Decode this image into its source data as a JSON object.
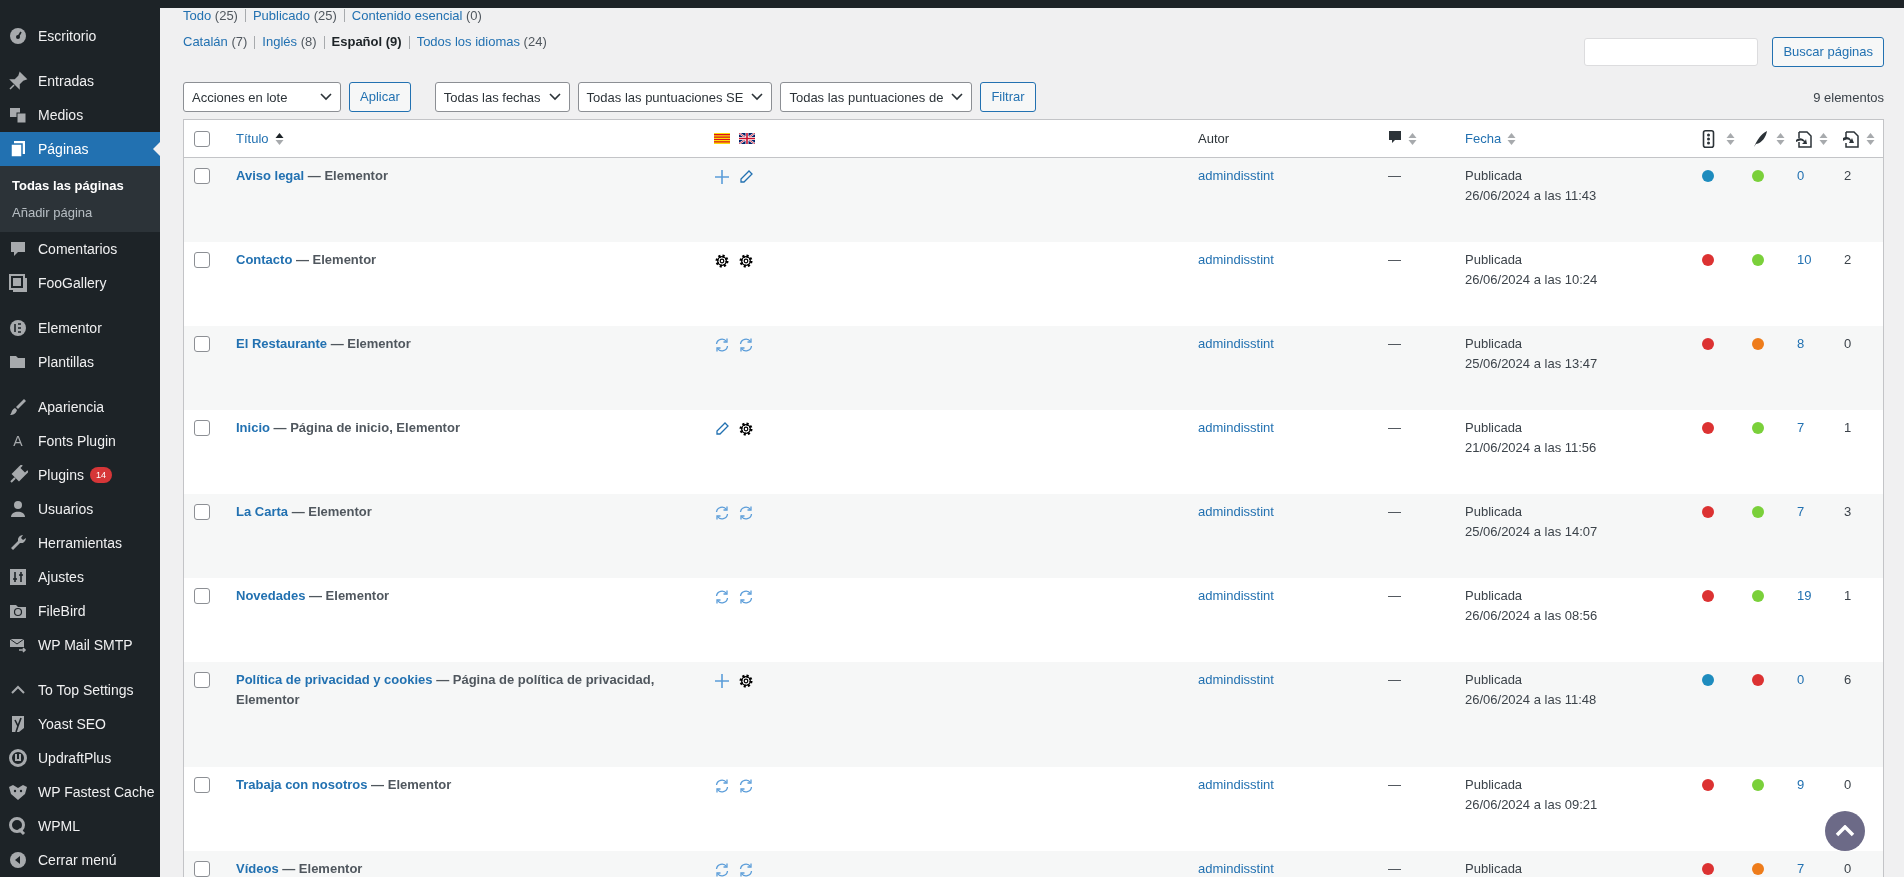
{
  "sidebar": {
    "groups": [
      {
        "items": [
          {
            "label": "Escritorio",
            "selected": false
          }
        ]
      },
      {
        "items": [
          {
            "label": "Entradas",
            "selected": false
          },
          {
            "label": "Medios",
            "selected": false
          },
          {
            "label": "Páginas",
            "selected": true,
            "children": [
              {
                "label": "Todas las páginas",
                "selected": true
              },
              {
                "label": "Añadir página",
                "selected": false
              }
            ]
          },
          {
            "label": "Comentarios",
            "selected": false
          },
          {
            "label": "FooGallery",
            "selected": false
          }
        ]
      },
      {
        "items": [
          {
            "label": "Elementor",
            "selected": false
          },
          {
            "label": "Plantillas",
            "selected": false
          }
        ]
      },
      {
        "items": [
          {
            "label": "Apariencia",
            "selected": false
          },
          {
            "label": "Fonts Plugin",
            "selected": false,
            "glyph": "A"
          },
          {
            "label": "Plugins",
            "selected": false,
            "badge": "14"
          },
          {
            "label": "Usuarios",
            "selected": false
          },
          {
            "label": "Herramientas",
            "selected": false
          },
          {
            "label": "Ajustes",
            "selected": false
          },
          {
            "label": "FileBird",
            "selected": false
          },
          {
            "label": "WP Mail SMTP",
            "selected": false
          }
        ]
      },
      {
        "items": [
          {
            "label": "To Top Settings",
            "selected": false
          },
          {
            "label": "Yoast SEO",
            "selected": false
          },
          {
            "label": "UpdraftPlus",
            "selected": false
          },
          {
            "label": "WP Fastest Cache",
            "selected": false
          },
          {
            "label": "WPML",
            "selected": false
          },
          {
            "label": "Cerrar menú",
            "selected": false
          }
        ]
      }
    ]
  },
  "status_filters": [
    {
      "label": "Todo",
      "count": "(25)"
    },
    {
      "label": "Publicado",
      "count": "(25)"
    },
    {
      "label": "Contenido esencial",
      "count": "(0)"
    }
  ],
  "language_filters": [
    {
      "label": "Catalán",
      "count": "(7)",
      "selected": false
    },
    {
      "label": "Inglés",
      "count": "(8)",
      "selected": false
    },
    {
      "label": "Español",
      "count": "(9)",
      "selected": true
    },
    {
      "label": "Todos los idiomas",
      "count": "(24)",
      "selected": false
    }
  ],
  "search": {
    "button": "Buscar páginas"
  },
  "tablenav": {
    "bulk_actions": "Acciones en lote",
    "apply": "Aplicar",
    "dropdowns": [
      "Todas las fechas",
      "Todas las puntuaciones SE",
      "Todas las puntuaciones de"
    ],
    "filter": "Filtrar",
    "count": "9 elementos"
  },
  "table": {
    "select_all_checked": false,
    "columns": [
      {
        "kind": "title",
        "label": "Título",
        "sorted": true
      },
      {
        "kind": "flags"
      },
      {
        "kind": "author",
        "label": "Autor"
      },
      {
        "kind": "comments",
        "sorted": false
      },
      {
        "kind": "date",
        "label": "Fecha",
        "sorted": false
      },
      {
        "kind": "seo",
        "sorted": false
      },
      {
        "kind": "readability",
        "sorted": false
      },
      {
        "kind": "links",
        "sorted": false
      },
      {
        "kind": "linked",
        "sorted": false
      }
    ],
    "rows": [
      {
        "checked": false,
        "title": "Aviso legal",
        "suffix": "— Elementor",
        "translations": [
          {
            "kind": "add"
          },
          {
            "kind": "edit"
          }
        ],
        "author": "admindisstint",
        "comments": "—",
        "status": "Publicada",
        "date": "26/06/2024 a las 11:43",
        "seo": {
          "color": "#1e8cbe"
        },
        "readability": {
          "color": "#7ad03a"
        },
        "links": "0",
        "linked": "2"
      },
      {
        "checked": false,
        "title": "Contacto",
        "suffix": "— Elementor",
        "translations": [
          {
            "kind": "settings"
          },
          {
            "kind": "settings"
          }
        ],
        "author": "admindisstint",
        "comments": "—",
        "status": "Publicada",
        "date": "26/06/2024 a las 10:24",
        "seo": {
          "color": "#dc3232"
        },
        "readability": {
          "color": "#7ad03a"
        },
        "links": "10",
        "linked": "2"
      },
      {
        "checked": false,
        "title": "El Restaurante",
        "suffix": "— Elementor",
        "translations": [
          {
            "kind": "sync"
          },
          {
            "kind": "sync"
          }
        ],
        "author": "admindisstint",
        "comments": "—",
        "status": "Publicada",
        "date": "25/06/2024 a las 13:47",
        "seo": {
          "color": "#dc3232"
        },
        "readability": {
          "color": "#ee7c1b"
        },
        "links": "8",
        "linked": "0"
      },
      {
        "checked": false,
        "title": "Inicio",
        "suffix": "— Página de inicio, Elementor",
        "translations": [
          {
            "kind": "edit"
          },
          {
            "kind": "settings"
          }
        ],
        "author": "admindisstint",
        "comments": "—",
        "status": "Publicada",
        "date": "21/06/2024 a las 11:56",
        "seo": {
          "color": "#dc3232"
        },
        "readability": {
          "color": "#7ad03a"
        },
        "links": "7",
        "linked": "1"
      },
      {
        "checked": false,
        "title": "La Carta",
        "suffix": "— Elementor",
        "translations": [
          {
            "kind": "sync"
          },
          {
            "kind": "sync"
          }
        ],
        "author": "admindisstint",
        "comments": "—",
        "status": "Publicada",
        "date": "25/06/2024 a las 14:07",
        "seo": {
          "color": "#dc3232"
        },
        "readability": {
          "color": "#7ad03a"
        },
        "links": "7",
        "linked": "3"
      },
      {
        "checked": false,
        "title": "Novedades",
        "suffix": "— Elementor",
        "translations": [
          {
            "kind": "sync"
          },
          {
            "kind": "sync"
          }
        ],
        "author": "admindisstint",
        "comments": "—",
        "status": "Publicada",
        "date": "26/06/2024 a las 08:56",
        "seo": {
          "color": "#dc3232"
        },
        "readability": {
          "color": "#7ad03a"
        },
        "links": "19",
        "linked": "1"
      },
      {
        "checked": false,
        "title": "Política de privacidad y cookies",
        "suffix": "— Página de política de privacidad, Elementor",
        "translations": [
          {
            "kind": "add"
          },
          {
            "kind": "settings"
          }
        ],
        "author": "admindisstint",
        "comments": "—",
        "status": "Publicada",
        "date": "26/06/2024 a las 11:48",
        "seo": {
          "color": "#1e8cbe"
        },
        "readability": {
          "color": "#dc3232"
        },
        "links": "0",
        "linked": "6"
      },
      {
        "checked": false,
        "title": "Trabaja con nosotros",
        "suffix": "— Elementor",
        "translations": [
          {
            "kind": "sync"
          },
          {
            "kind": "sync"
          }
        ],
        "author": "admindisstint",
        "comments": "—",
        "status": "Publicada",
        "date": "26/06/2024 a las 09:21",
        "seo": {
          "color": "#dc3232"
        },
        "readability": {
          "color": "#7ad03a"
        },
        "links": "9",
        "linked": "0"
      },
      {
        "checked": false,
        "title": "Vídeos",
        "suffix": "— Elementor",
        "translations": [
          {
            "kind": "sync"
          },
          {
            "kind": "sync"
          }
        ],
        "author": "admindisstint",
        "comments": "—",
        "status": "Publicada",
        "seo": {
          "color": "#dc3232"
        },
        "readability": {
          "color": "#ee7c1b"
        },
        "links": "7",
        "linked": "0"
      }
    ]
  }
}
